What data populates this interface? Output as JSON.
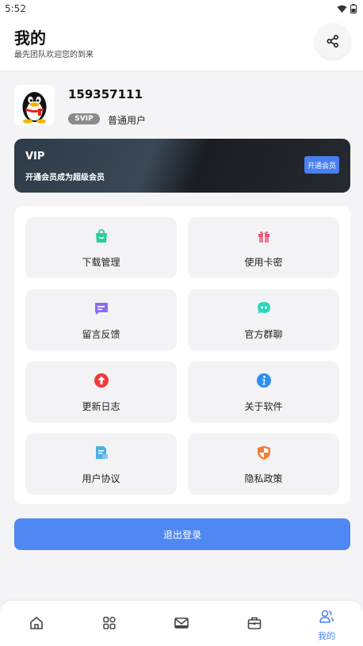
{
  "status_bar": {
    "time": "5:52"
  },
  "header": {
    "title": "我的",
    "subtitle": "最先团队欢迎您的到来"
  },
  "profile": {
    "username": "159357111",
    "badge": "SVIP",
    "level": "普通用户"
  },
  "vip_card": {
    "title": "VIP",
    "subtitle": "开通会员成为超级会员",
    "button_label": "开通会员"
  },
  "menu": {
    "items": [
      {
        "label": "下载管理",
        "icon": "shopping-bag-icon",
        "color": "#2ecc9a"
      },
      {
        "label": "使用卡密",
        "icon": "gift-icon",
        "color": "#f0577a"
      },
      {
        "label": "留言反馈",
        "icon": "message-icon",
        "color": "#8a6cf0"
      },
      {
        "label": "官方群聊",
        "icon": "chat-group-icon",
        "color": "#2ed6c0"
      },
      {
        "label": "更新日志",
        "icon": "upload-arrow-icon",
        "color": "#ee3b3b"
      },
      {
        "label": "关于软件",
        "icon": "info-icon",
        "color": "#2f8ef0"
      },
      {
        "label": "用户协议",
        "icon": "document-icon",
        "color": "#4fb0e8"
      },
      {
        "label": "隐私政策",
        "icon": "shield-icon",
        "color": "#f07f3b"
      }
    ]
  },
  "logout_label": "退出登录",
  "bottom_nav": {
    "items": [
      {
        "icon": "home-icon",
        "label": ""
      },
      {
        "icon": "grid-icon",
        "label": ""
      },
      {
        "icon": "mail-icon",
        "label": ""
      },
      {
        "icon": "toolbox-icon",
        "label": ""
      },
      {
        "icon": "profile-icon",
        "label": "我的"
      }
    ],
    "active_color": "#4f87f3"
  }
}
